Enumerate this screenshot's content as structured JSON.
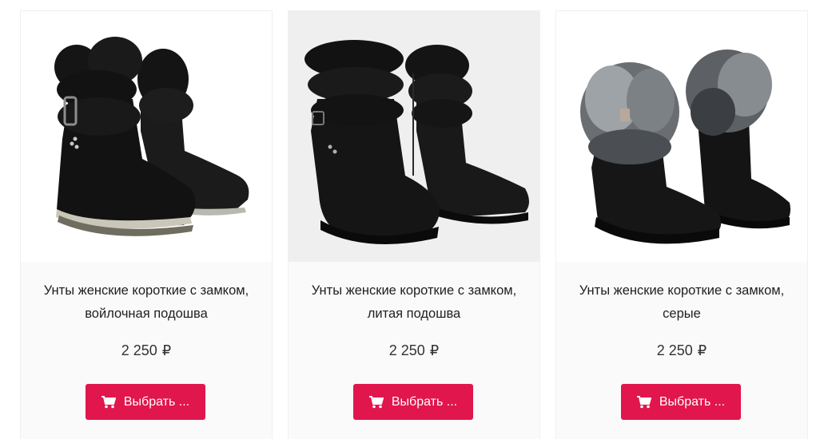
{
  "products": [
    {
      "title_line1": "Унты женские короткие с замком,",
      "title_line2": "войлочная подошва",
      "price": "2 250",
      "currency": "₽",
      "button_label": "Выбрать ...",
      "button_icon": "cart-icon",
      "image_icon": "boots-image"
    },
    {
      "title_line1": "Унты женские короткие с замком,",
      "title_line2": "литая подошва",
      "price": "2 250",
      "currency": "₽",
      "button_label": "Выбрать ...",
      "button_icon": "cart-icon",
      "image_icon": "boots-image"
    },
    {
      "title_line1": "Унты женские короткие с замком,",
      "title_line2": "серые",
      "price": "2 250",
      "currency": "₽",
      "button_label": "Выбрать ...",
      "button_icon": "cart-icon",
      "image_icon": "boots-image"
    }
  ],
  "colors": {
    "button": "#e0164d",
    "card_background": "#fafafa",
    "text": "#1f1f1f"
  }
}
